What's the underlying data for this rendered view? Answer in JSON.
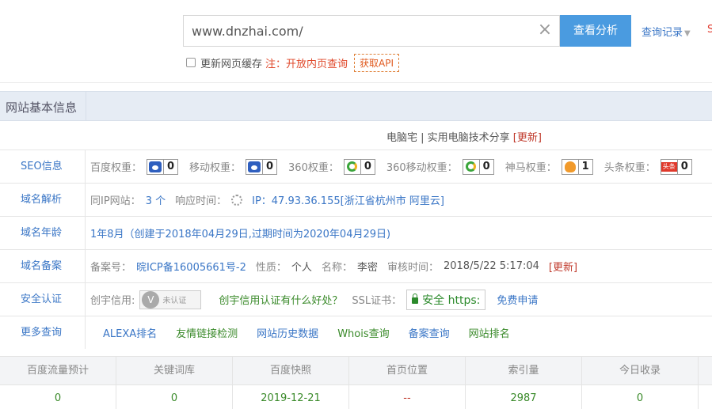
{
  "search": {
    "value": "www.dnzhai.com/",
    "clear_glyph": "×",
    "button": "查看分析",
    "history": "查询记录",
    "edge_text": "S"
  },
  "options": {
    "refresh_label": "更新网页缓存",
    "note": "注：开放内页查询",
    "api_button": "获取API"
  },
  "section": {
    "title": "网站基本信息"
  },
  "site": {
    "title": "电脑宅 | 实用电脑技术分享",
    "update": "[更新]"
  },
  "seo": {
    "label": "SEO信息",
    "items": [
      {
        "name": "百度权重：",
        "value": "0",
        "icon": "baidu-paw-icon"
      },
      {
        "name": "移动权重：",
        "value": "0",
        "icon": "baidu-paw-icon"
      },
      {
        "name": "360权重：",
        "value": "0",
        "icon": "360-ring-icon"
      },
      {
        "name": "360移动权重：",
        "value": "0",
        "icon": "360-ring-icon"
      },
      {
        "name": "神马权重：",
        "value": "1",
        "icon": "shenma-icon"
      },
      {
        "name": "头条权重：",
        "value": "0",
        "icon": "toutiao-icon",
        "icon_text": "头条"
      }
    ]
  },
  "dns": {
    "label": "域名解析",
    "same_ip_label": "同IP网站：",
    "same_ip_value": "3 个",
    "resp_label": "响应时间：",
    "ip_text": "IP：47.93.36.155[浙江省杭州市 阿里云]"
  },
  "age": {
    "label": "域名年龄",
    "value": "1年8月（创建于2018年04月29日,过期时间为2020年04月29日)"
  },
  "icp": {
    "label": "域名备案",
    "num_label": "备案号：",
    "num_value": "晥ICP备16005661号-2",
    "type_label": "性质：",
    "type_value": "个人",
    "name_label": "名称：",
    "name_value": "李密",
    "time_label": "审核时间：",
    "time_value": "2018/5/22 5:17:04",
    "update": "[更新]"
  },
  "security": {
    "label": "安全认证",
    "credit_label": "创宇信用:",
    "cert_mark": "V",
    "cert_text": "未认证",
    "credit_link": "创宇信用认证有什么好处？",
    "ssl_label": "SSL证书：",
    "ssl_text": "安全 https:",
    "apply": "免费申请"
  },
  "more": {
    "label": "更多查询",
    "links": [
      "ALEXA排名",
      "友情链接检测",
      "网站历史数据",
      "Whois查询",
      "备案查询",
      "网站排名"
    ]
  },
  "stats": {
    "headers": [
      "百度流量预计",
      "关键词库",
      "百度快照",
      "首页位置",
      "索引量",
      "今日收录"
    ],
    "values": [
      "0",
      "0",
      "2019-12-21",
      "--",
      "2987",
      "0"
    ],
    "colors": {
      "normal": "#3a8a2a",
      "dash": "#c0392b"
    }
  }
}
